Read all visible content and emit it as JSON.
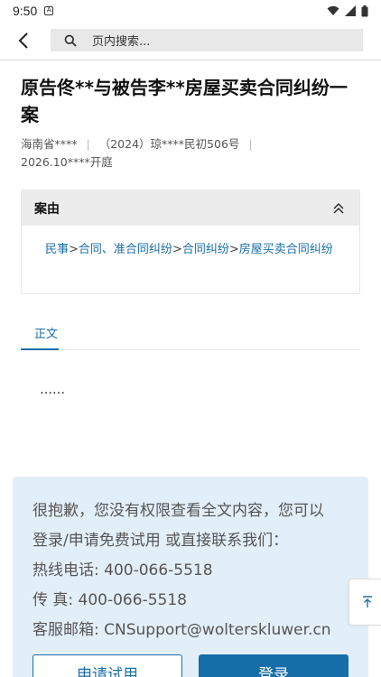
{
  "status_bar": {
    "time": "9:50",
    "notification_glyph": "A"
  },
  "search": {
    "placeholder": "页内搜索..."
  },
  "case": {
    "title": "原告佟**与被告李**房屋买卖合同纠纷一案",
    "court": "海南省****",
    "case_number": "（2024）琼****民初506号",
    "hearing": "2026.10****开庭"
  },
  "cause": {
    "label": "案由",
    "path": [
      "民事",
      "合同、准合同纠纷",
      "合同纠纷",
      "房屋买卖合同纠纷"
    ],
    "separator": ">"
  },
  "tabs": [
    {
      "label": "正文"
    }
  ],
  "body": {
    "text": "……"
  },
  "notice": {
    "line1": "很抱歉，您没有权限查看全文内容，您可以",
    "line2": "登录/申请免费试用 或直接联系我们：",
    "hotline": "热线电话: 400-066-5518",
    "fax": "传 真: 400-066-5518",
    "email": "客服邮箱: CNSupport@wolterskluwer.cn"
  },
  "buttons": {
    "trial": "申请试用",
    "login": "登录"
  },
  "colors": {
    "accent": "#1a6fa8",
    "notice_bg": "#e3eff8",
    "header_bg": "#ececec"
  }
}
